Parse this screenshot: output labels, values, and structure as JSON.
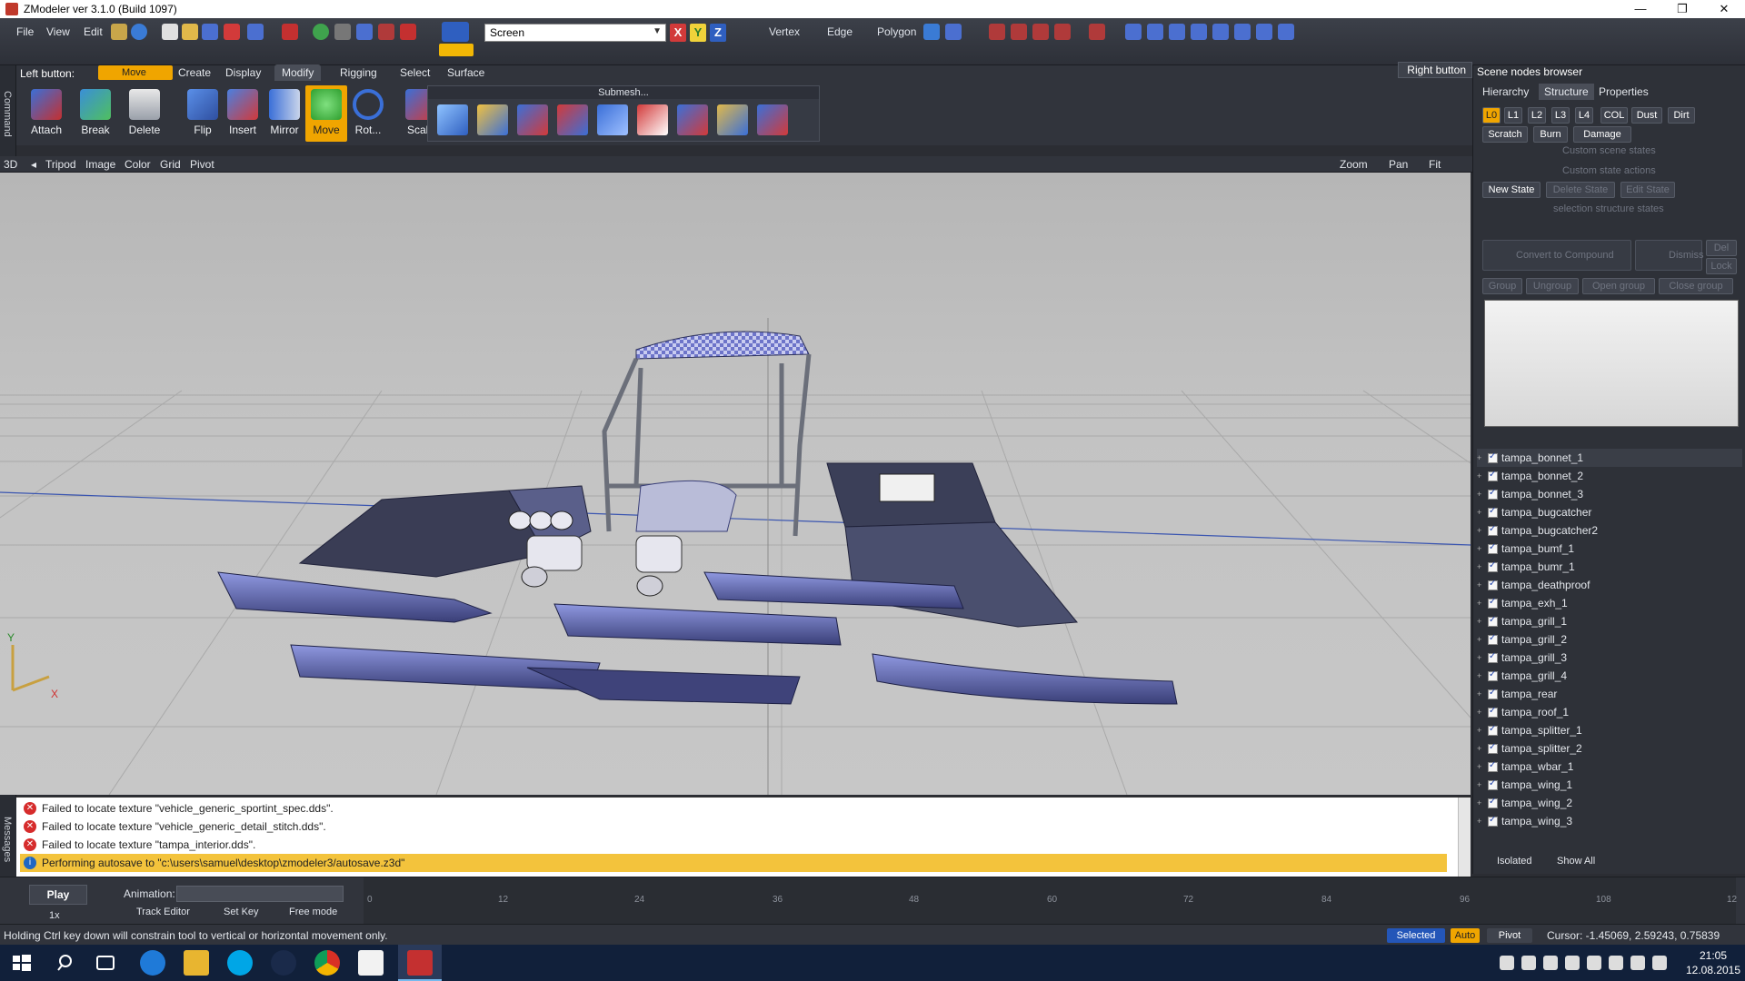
{
  "window": {
    "title": "ZModeler ver 3.1.0 (Build 1097)",
    "minimize": "—",
    "restore": "❐",
    "close": "✕"
  },
  "menu": {
    "file": "File",
    "view": "View",
    "edit": "Edit"
  },
  "toolbar": {
    "screen_select_value": "Screen",
    "axis_x": "X",
    "axis_y": "Y",
    "axis_z": "Z",
    "vertex": "Vertex",
    "edge": "Edge",
    "polygon": "Polygon"
  },
  "leftstrip": {
    "command_label": "Command",
    "messages_label": "Messages"
  },
  "command_panel": {
    "left_button_label": "Left button:",
    "left_button_value": "Move",
    "right_button_label": "Right button",
    "tabs": [
      "Create",
      "Display",
      "Modify",
      "Rigging",
      "Select",
      "Surface"
    ],
    "active_tab": "Modify",
    "tools": [
      "Attach",
      "Break",
      "Delete",
      "Flip",
      "Insert",
      "Mirror",
      "Move",
      "Rot...",
      "Scale"
    ],
    "active_tool": "Move",
    "submesh_header": "Submesh..."
  },
  "viewport_bar": {
    "mode": "3D",
    "items": [
      "Tripod",
      "Image",
      "Color",
      "Grid",
      "Pivot"
    ],
    "zoom": "Zoom",
    "pan": "Pan",
    "fit": "Fit"
  },
  "axes": {
    "y": "Y",
    "x": "X"
  },
  "right_panel": {
    "title": "Scene nodes browser",
    "tabs": [
      "Hierarchy",
      "Structure",
      "Properties"
    ],
    "active_tab": "Structure",
    "lod_buttons": [
      "L0",
      "L1",
      "L2",
      "L3",
      "L4",
      "COL",
      "Dust",
      "Dirt"
    ],
    "state_buttons": [
      "Scratch",
      "Burn",
      "Damage"
    ],
    "custom_scene_states": "Custom scene states",
    "custom_state_actions": "Custom state actions",
    "new_state": "New State",
    "delete_state": "Delete State",
    "edit_state": "Edit State",
    "selection_structure_states": "selection structure states",
    "convert_to_compound": "Convert to Compound",
    "dismiss": "Dismiss",
    "del": "Del",
    "lock": "Lock",
    "group_buttons": [
      "Group",
      "Ungroup",
      "Open group",
      "Close group"
    ],
    "nodes": [
      "tampa_bonnet_1",
      "tampa_bonnet_2",
      "tampa_bonnet_3",
      "tampa_bugcatcher",
      "tampa_bugcatcher2",
      "tampa_bumf_1",
      "tampa_bumr_1",
      "tampa_deathproof",
      "tampa_exh_1",
      "tampa_grill_1",
      "tampa_grill_2",
      "tampa_grill_3",
      "tampa_grill_4",
      "tampa_rear",
      "tampa_roof_1",
      "tampa_splitter_1",
      "tampa_splitter_2",
      "tampa_wbar_1",
      "tampa_wing_1",
      "tampa_wing_2",
      "tampa_wing_3"
    ],
    "isolated": "Isolated",
    "show_all": "Show All"
  },
  "messages": [
    {
      "type": "error",
      "text": "Failed to locate texture \"vehicle_generic_sportint_spec.dds\"."
    },
    {
      "type": "error",
      "text": "Failed to locate texture \"vehicle_generic_detail_stitch.dds\"."
    },
    {
      "type": "error",
      "text": "Failed to locate texture \"tampa_interior.dds\"."
    },
    {
      "type": "info",
      "text": "Performing autosave to \"c:\\users\\samuel\\desktop\\zmodeler3/autosave.z3d\""
    }
  ],
  "animation": {
    "play": "Play",
    "animation_label": "Animation:",
    "speed": "1x",
    "ticks": [
      "0",
      "12",
      "24",
      "36",
      "48",
      "60",
      "72",
      "84",
      "96",
      "108",
      "12"
    ],
    "track_editor": "Track Editor",
    "set_key": "Set Key",
    "free_mode": "Free mode"
  },
  "status": {
    "hint": "Holding Ctrl key down will constrain tool to vertical or horizontal movement only.",
    "selected": "Selected",
    "auto": "Auto",
    "pivot": "Pivot",
    "cursor": "Cursor: -1.45069, 2.59243, 0.75839"
  },
  "taskbar": {
    "time": "21:05",
    "date": "12.08.2015"
  },
  "colors": {
    "accent": "#f0a500",
    "panel": "#31343c",
    "viewport": "#c0c0c0",
    "taskbar": "#11203a"
  }
}
